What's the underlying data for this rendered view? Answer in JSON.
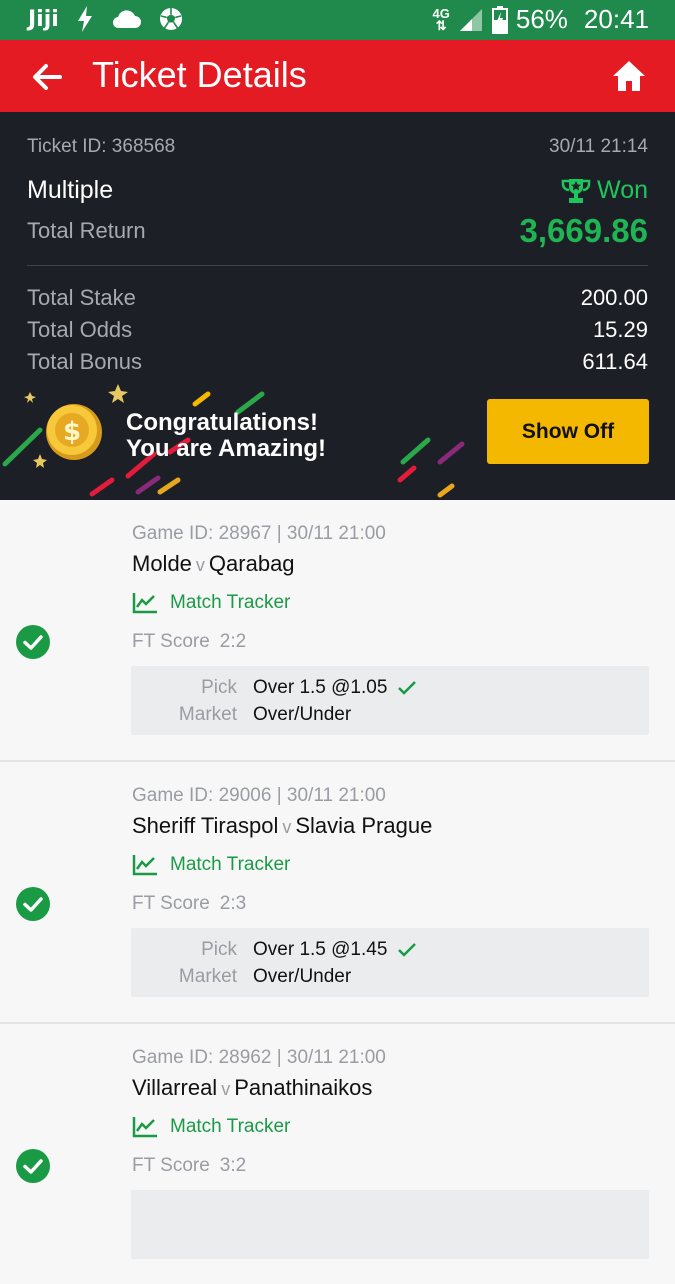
{
  "status_bar": {
    "app_label": "Jiji",
    "network": "4G",
    "battery": "56%",
    "time": "20:41"
  },
  "header": {
    "title": "Ticket Details"
  },
  "ticket": {
    "id_text": "Ticket ID: 368568",
    "datetime": "30/11 21:14",
    "type": "Multiple",
    "status": "Won",
    "total_return_label": "Total Return",
    "total_return_value": "3,669.86",
    "rows": [
      {
        "label": "Total Stake",
        "value": "200.00"
      },
      {
        "label": "Total Odds",
        "value": "15.29"
      },
      {
        "label": "Total Bonus",
        "value": "611.64"
      }
    ],
    "banner_line1": "Congratulations!",
    "banner_line2": "You are Amazing!",
    "show_off_label": "Show Off"
  },
  "labels": {
    "versus": "v",
    "match_tracker": "Match Tracker",
    "ft_score": "FT Score",
    "pick": "Pick",
    "market": "Market"
  },
  "games": [
    {
      "game_id_text": "Game ID: 28967 | 30/11 21:00",
      "home": "Molde",
      "away": "Qarabag",
      "score": "2:2",
      "pick": "Over 1.5 @1.05",
      "market": "Over/Under"
    },
    {
      "game_id_text": "Game ID: 29006 | 30/11 21:00",
      "home": "Sheriff Tiraspol",
      "away": "Slavia Prague",
      "score": "2:3",
      "pick": "Over 1.5 @1.45",
      "market": "Over/Under"
    },
    {
      "game_id_text": "Game ID: 28962 | 30/11 21:00",
      "home": "Villarreal",
      "away": "Panathinaikos",
      "score": "3:2",
      "pick": "",
      "market": ""
    }
  ],
  "colors": {
    "status_bar": "#1f8a4c",
    "app_bar": "#e41b23",
    "summary_bg": "#1d1f26",
    "won_green": "#1fb553",
    "show_off_yellow": "#f5b800"
  }
}
